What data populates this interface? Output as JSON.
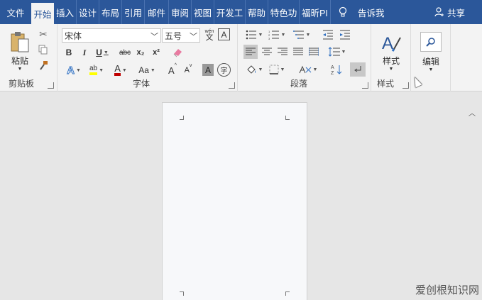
{
  "tabs": [
    {
      "label": "文件",
      "active": false
    },
    {
      "label": "开始",
      "active": true
    },
    {
      "label": "插入",
      "active": false
    },
    {
      "label": "设计",
      "active": false
    },
    {
      "label": "布局",
      "active": false
    },
    {
      "label": "引用",
      "active": false
    },
    {
      "label": "邮件",
      "active": false
    },
    {
      "label": "审阅",
      "active": false
    },
    {
      "label": "视图",
      "active": false
    },
    {
      "label": "开发工",
      "active": false
    },
    {
      "label": "帮助",
      "active": false
    },
    {
      "label": "特色功",
      "active": false
    },
    {
      "label": "福昕PI",
      "active": false
    }
  ],
  "tell_me": "告诉我",
  "share": "共享",
  "clipboard": {
    "label": "剪贴板",
    "paste": "粘贴"
  },
  "font": {
    "label": "字体",
    "font_name": "宋体",
    "font_size": "五号",
    "wen": "wén",
    "wen_char": "文",
    "bold": "B",
    "italic": "I",
    "underline": "U",
    "strike": "abc",
    "sub": "x₂",
    "sup": "x²",
    "aa": "Aa",
    "grow": "A",
    "shrink": "A",
    "shade": "A",
    "circle": "字"
  },
  "paragraph": {
    "label": "段落"
  },
  "styles": {
    "label": "样式",
    "button": "样式"
  },
  "editing": {
    "button": "编辑"
  },
  "watermark": "爱创根知识网",
  "colors": {
    "accent": "#2b579a",
    "ribbon": "#f3f3f3",
    "highlight": "#ffff00",
    "font_red": "#c00000"
  }
}
